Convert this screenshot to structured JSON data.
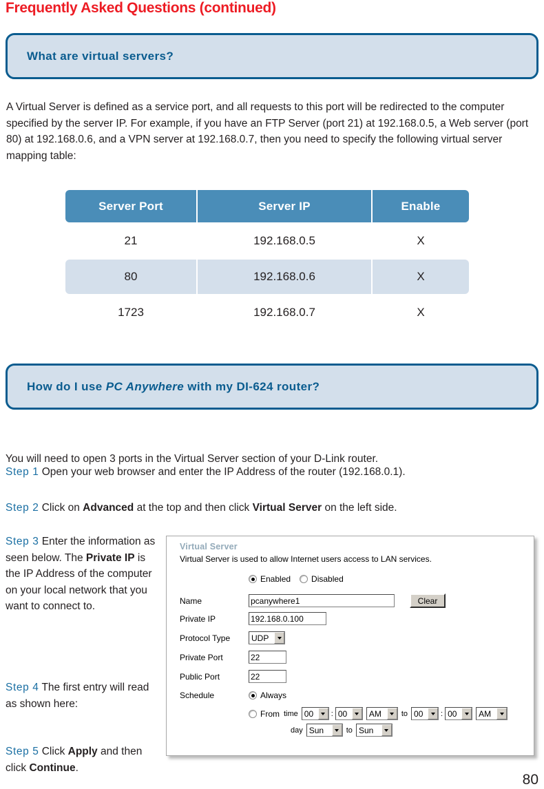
{
  "page": {
    "title": "Frequently Asked Questions (continued)",
    "number": "80"
  },
  "faq": [
    {
      "question_prefix": "What are virtual servers?",
      "question_italic": "",
      "question_suffix": ""
    },
    {
      "question_prefix": "How do I use ",
      "question_italic": "PC Anywhere",
      "question_suffix": " with my DI-624 router?"
    }
  ],
  "virtual_server_paragraph": "A Virtual Server is defined as a service port, and all requests to this port will be redirected to the computer specified by the server IP. For example, if you have an FTP Server (port 21) at 192.168.0.5, a Web server (port 80) at 192.168.0.6, and a VPN server at 192.168.0.7, then you need to specify the following virtual server mapping table:",
  "mapping_table": {
    "headers": [
      "Server Port",
      "Server IP",
      "Enable"
    ],
    "rows": [
      [
        "21",
        "192.168.0.5",
        "X"
      ],
      [
        "80",
        "192.168.0.6",
        "X"
      ],
      [
        "1723",
        "192.168.0.7",
        "X"
      ]
    ]
  },
  "pcanywhere": {
    "intro": "You will need to open 3 ports in the Virtual Server section of your D-Link router.",
    "step1_label": "Step 1",
    "step1_text": "Open your web browser and enter the IP Address of the router (192.168.0.1).",
    "step2_label": "Step 2",
    "step2_a": "Click on ",
    "step2_b": "Advanced",
    "step2_c": " at the top and then click ",
    "step2_d": "Virtual Server",
    "step2_e": " on the left side.",
    "step3_label": "Step 3",
    "step3_a": "Enter the information as seen below. The ",
    "step3_b": "Private IP",
    "step3_c": " is the IP Address of the computer on your local network that you want to connect to.",
    "step4_label": "Step 4",
    "step4_text": "The first entry will read as shown here:",
    "step5_label": "Step 5",
    "step5_a": "Click ",
    "step5_b": "Apply",
    "step5_c": " and then click ",
    "step5_d": "Continue",
    "step5_e": "."
  },
  "router_ui": {
    "panel_title": "Virtual Server",
    "panel_subtitle": "Virtual Server is used to allow Internet users access to LAN services.",
    "enabled_label": "Enabled",
    "disabled_label": "Disabled",
    "enabled_selected": true,
    "fields": {
      "name_label": "Name",
      "name_value": "pcanywhere1",
      "clear_button": "Clear",
      "private_ip_label": "Private IP",
      "private_ip_value": "192.168.0.100",
      "protocol_label": "Protocol Type",
      "protocol_value": "UDP",
      "private_port_label": "Private Port",
      "private_port_value": "22",
      "public_port_label": "Public Port",
      "public_port_value": "22"
    },
    "schedule": {
      "label": "Schedule",
      "always_label": "Always",
      "from_label": "From",
      "time_label": "time",
      "day_label": "day",
      "to_label": "to",
      "colon": ":",
      "from_hour": "00",
      "from_min": "00",
      "from_ampm": "AM",
      "to_hour": "00",
      "to_min": "00",
      "to_ampm": "AM",
      "from_day": "Sun",
      "to_day": "Sun",
      "always_selected": true
    }
  },
  "colors": {
    "title_red": "#ed1c24",
    "banner_fill": "#d3dfeb",
    "banner_border": "#0a5c8f",
    "table_header": "#4a8db8",
    "table_alt_row": "#d4dfeb",
    "step_blue": "#1a6fa3",
    "panel_title_blue": "#93aab9"
  }
}
